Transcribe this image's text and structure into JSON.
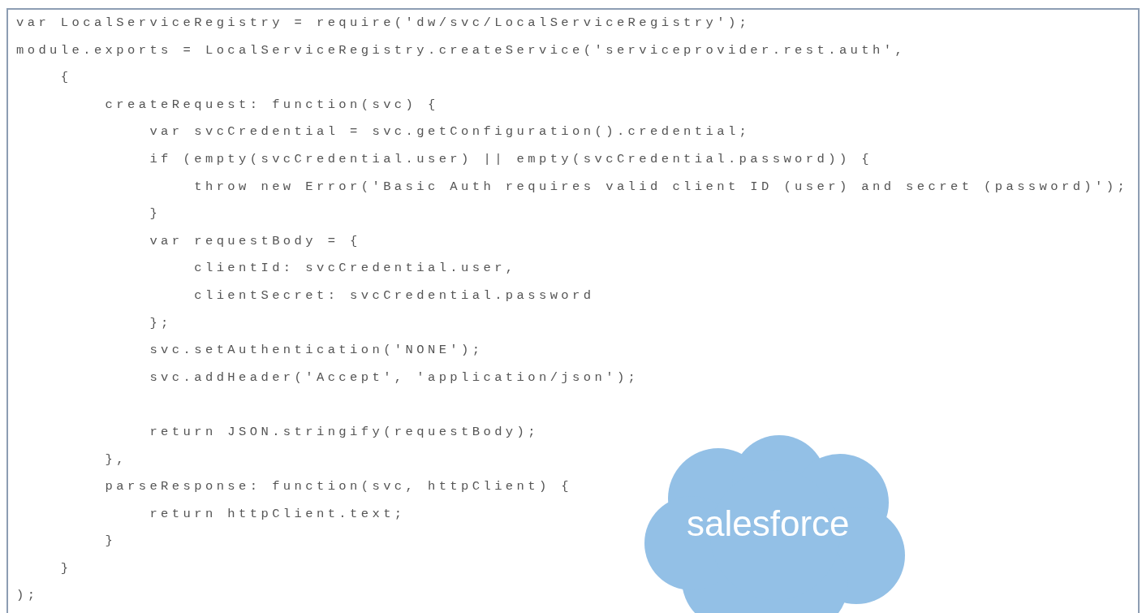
{
  "code_lines": [
    {
      "text": "var LocalServiceRegistry = require('dw/svc/LocalServiceRegistry');"
    },
    {
      "text": "module.exports = LocalServiceRegistry.createService('serviceprovider.rest.auth',"
    },
    {
      "text": "    {"
    },
    {
      "text": "        createRequest: function(svc) {"
    },
    {
      "text": "            var svcCredential = svc.getConfiguration().credential;"
    },
    {
      "text": "            if (empty(svcCredential.user) || empty(svcCredential.password)) {"
    },
    {
      "text": "                throw new Error('Basic Auth requires valid client ID (user) and secret (password)');"
    },
    {
      "text": "            }"
    },
    {
      "text": "            var requestBody = {"
    },
    {
      "text": "                clientId: svcCredential.user,"
    },
    {
      "text": "                clientSecret: svcCredential.password"
    },
    {
      "text": "            };"
    },
    {
      "text": "            svc.setAuthentication('NONE');"
    },
    {
      "text": "            svc.addHeader('Accept', 'application/json');"
    },
    {
      "text": "            return JSON.stringify(requestBody);",
      "blank_before": true
    },
    {
      "text": "        },"
    },
    {
      "text": "        parseResponse: function(svc, httpClient) {"
    },
    {
      "text": "            return httpClient.text;"
    },
    {
      "text": "        }"
    },
    {
      "text": "    }"
    },
    {
      "text": ");"
    }
  ],
  "logo": {
    "text": "salesforce"
  }
}
